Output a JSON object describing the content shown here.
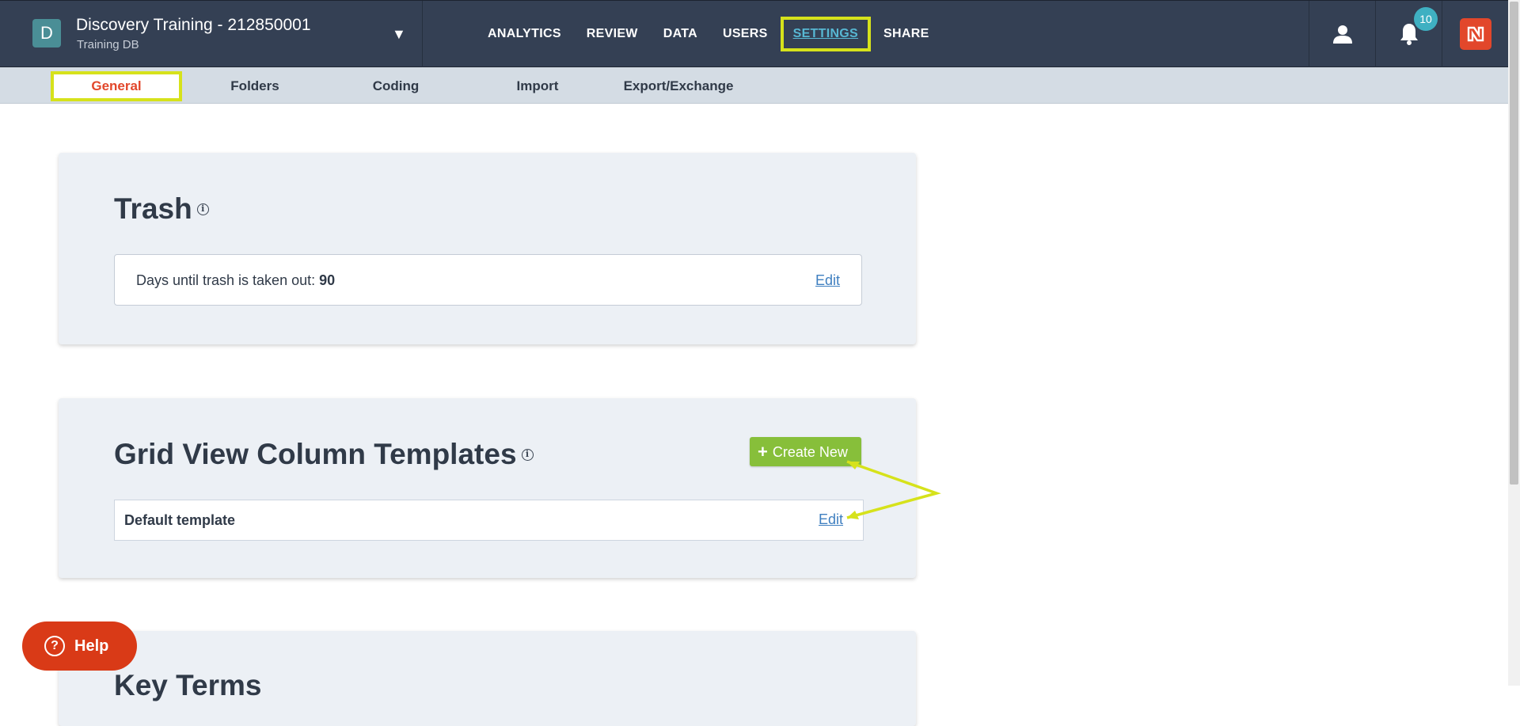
{
  "header": {
    "db_initial": "D",
    "db_title": "Discovery Training - 212850001",
    "db_subtitle": "Training DB",
    "caret": "▼",
    "nav": [
      {
        "label": "ANALYTICS"
      },
      {
        "label": "REVIEW"
      },
      {
        "label": "DATA"
      },
      {
        "label": "USERS"
      },
      {
        "label": "SETTINGS",
        "active": true
      },
      {
        "label": "SHARE"
      }
    ],
    "notification_count": "10",
    "icons": [
      "user-icon",
      "bell-icon",
      "brand-logo-icon"
    ]
  },
  "subnav": {
    "items": [
      {
        "label": "General",
        "active": true
      },
      {
        "label": "Folders"
      },
      {
        "label": "Coding"
      },
      {
        "label": "Import"
      },
      {
        "label": "Export/Exchange"
      }
    ]
  },
  "trash": {
    "title": "Trash",
    "days_label": "Days until trash is taken out: ",
    "days_value": "90",
    "edit_label": "Edit"
  },
  "grid_templates": {
    "title": "Grid View Column Templates",
    "create_label": "Create New",
    "rows": [
      {
        "name": "Default template",
        "edit_label": "Edit"
      }
    ]
  },
  "key_terms": {
    "title": "Key Terms"
  },
  "help": {
    "label": "Help"
  },
  "colors": {
    "topbar": "#344054",
    "subnav": "#d4dce4",
    "active_nav": "#57b7d3",
    "active_sub": "#e2472b",
    "highlight": "#d6e21b",
    "create_button": "#87bf3a",
    "help_button": "#d93a17",
    "badge": "#3fb0c2"
  }
}
